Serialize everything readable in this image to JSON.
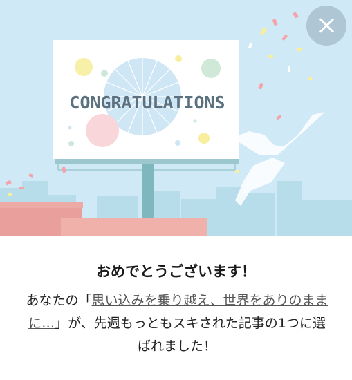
{
  "hero": {
    "billboard_text": "CONGRATULATIONS"
  },
  "dialog": {
    "title": "おめでとうございます！",
    "body_prefix": "あなたの「",
    "article_title": "思い込みを乗り越え、世界をありのままに…",
    "body_suffix": "」が、先週もっともスキされた記事の1つに選ばれました！"
  },
  "icons": {
    "close": "close-icon"
  }
}
